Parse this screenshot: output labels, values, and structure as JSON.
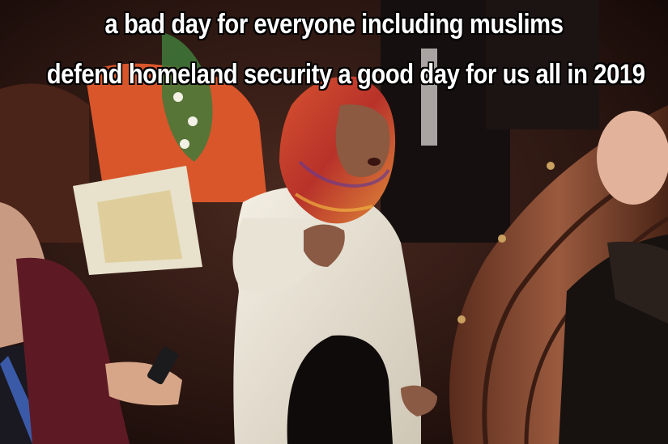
{
  "meme": {
    "top_text": "a bad day for everyone including muslims",
    "bottom_text": "defend homeland security  a good day for us all in 2019"
  },
  "colors": {
    "background": "#2a1612",
    "caption_fill": "#ffffff",
    "caption_outline": "#000000",
    "hijab": "#c0392b",
    "sweater": "#ece6d8",
    "pew_wood": "#8a4a30"
  }
}
